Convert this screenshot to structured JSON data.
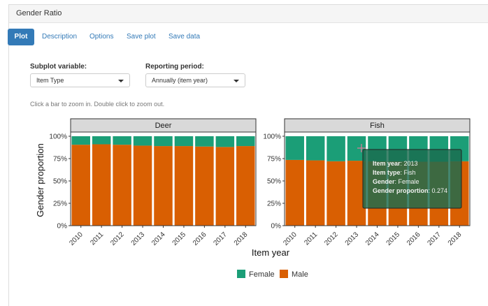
{
  "panel": {
    "title": "Gender Ratio"
  },
  "tabs": [
    "Plot",
    "Description",
    "Options",
    "Save plot",
    "Save data"
  ],
  "controls": {
    "subplot": {
      "label": "Subplot variable:",
      "value": "Item Type"
    },
    "period": {
      "label": "Reporting period:",
      "value": "Annually (item year)"
    }
  },
  "hint": "Click a bar to zoom in. Double click to zoom out.",
  "colors": {
    "female": "#1b9e77",
    "male": "#d95f02",
    "accent": "#337ab7"
  },
  "chart_data": {
    "type": "bar",
    "stacked": true,
    "facets": [
      {
        "name": "Deer",
        "categories": [
          "2010",
          "2011",
          "2012",
          "2013",
          "2014",
          "2015",
          "2016",
          "2017",
          "2018"
        ],
        "series": [
          {
            "name": "Female",
            "values": [
              0.095,
              0.09,
              0.095,
              0.105,
              0.11,
              0.11,
              0.115,
              0.12,
              0.11
            ]
          },
          {
            "name": "Male",
            "values": [
              0.905,
              0.91,
              0.905,
              0.895,
              0.89,
              0.89,
              0.885,
              0.88,
              0.89
            ]
          }
        ]
      },
      {
        "name": "Fish",
        "categories": [
          "2010",
          "2011",
          "2012",
          "2013",
          "2014",
          "2015",
          "2016",
          "2017",
          "2018"
        ],
        "series": [
          {
            "name": "Female",
            "values": [
              0.265,
              0.27,
              0.28,
              0.274,
              0.28,
              0.28,
              0.285,
              0.285,
              0.28
            ]
          },
          {
            "name": "Male",
            "values": [
              0.735,
              0.73,
              0.72,
              0.726,
              0.72,
              0.72,
              0.715,
              0.715,
              0.72
            ]
          }
        ]
      }
    ],
    "yticks": [
      "0%",
      "25%",
      "50%",
      "75%",
      "100%"
    ],
    "ylim": [
      0,
      1
    ],
    "xlabel": "Item year",
    "ylabel": "Gender proportion",
    "legend": {
      "position": "bottom",
      "entries": [
        "Female",
        "Male"
      ]
    },
    "tooltip": {
      "rows": [
        {
          "key": "Item year",
          "value": "2013"
        },
        {
          "key": "Item type",
          "value": "Fish"
        },
        {
          "key": "Gender",
          "value": "Female"
        },
        {
          "key": "Gender proportion",
          "value": "0.274"
        }
      ]
    }
  }
}
